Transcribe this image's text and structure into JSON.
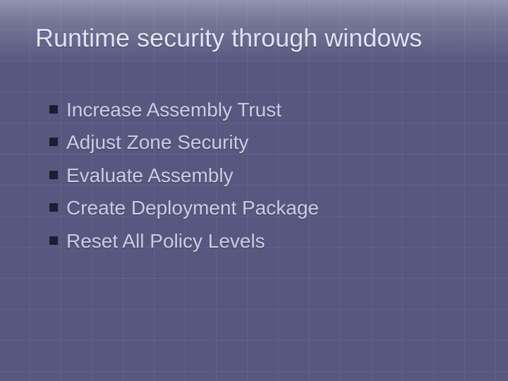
{
  "title": "Runtime security through windows",
  "bullets": [
    "Increase Assembly Trust",
    "Adjust Zone Security",
    "Evaluate Assembly",
    "Create Deployment Package",
    "Reset All Policy Levels"
  ]
}
